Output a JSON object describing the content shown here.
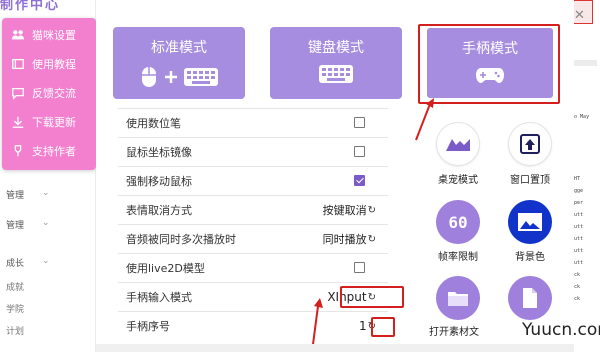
{
  "background_app": {
    "title": "制作中心",
    "menu_items": [
      {
        "label": "管理",
        "icon": "chevron-down-icon"
      },
      {
        "label": "管理",
        "icon": "chevron-down-icon"
      },
      {
        "label": "成长",
        "icon": "chevron-down-icon"
      }
    ],
    "sub_items": [
      "成就",
      "学院",
      "计划"
    ]
  },
  "pink_menu": {
    "color": "#f37fcf",
    "items": [
      {
        "label": "猫咪设置",
        "icon": "users-icon"
      },
      {
        "label": "使用教程",
        "icon": "book-icon"
      },
      {
        "label": "反馈交流",
        "icon": "chat-icon"
      },
      {
        "label": "下载更新",
        "icon": "download-icon"
      },
      {
        "label": "支持作者",
        "icon": "support-icon"
      }
    ]
  },
  "mode_buttons": [
    {
      "label": "标准模式",
      "icon": "mouse-keyboard-icon",
      "active": false
    },
    {
      "label": "键盘模式",
      "icon": "keyboard-icon",
      "active": false
    },
    {
      "label": "手柄模式",
      "icon": "gamepad-icon",
      "active": true
    }
  ],
  "accent_color": "#a78de0",
  "highlight_color": "#d41f1f",
  "settings": [
    {
      "label": "使用数位笔",
      "type": "checkbox",
      "checked": false
    },
    {
      "label": "鼠标坐标镜像",
      "type": "checkbox",
      "checked": false
    },
    {
      "label": "强制移动鼠标",
      "type": "checkbox",
      "checked": true
    },
    {
      "label": "表情取消方式",
      "type": "cycle",
      "value": "按键取消"
    },
    {
      "label": "音频被同时多次播放时",
      "type": "cycle",
      "value": "同时播放"
    },
    {
      "label": "使用live2D模型",
      "type": "checkbox",
      "checked": false
    },
    {
      "label": "手柄输入模式",
      "type": "cycle",
      "value": "XInput"
    },
    {
      "label": "手柄序号",
      "type": "cycle",
      "value": "1"
    }
  ],
  "right_icons": [
    {
      "label": "桌宠模式",
      "icon": "desk-pet-icon"
    },
    {
      "label": "窗口置顶",
      "icon": "pin-top-icon"
    },
    {
      "label": "帧率限制",
      "icon_text": "60",
      "icon": "fps-icon"
    },
    {
      "label": "背景色",
      "icon": "background-color-icon"
    },
    {
      "label": "打开素材文",
      "icon": "folder-icon"
    },
    {
      "label": "",
      "icon": "file-icon"
    }
  ],
  "right_bg": {
    "lines": [
      "Audo May",
      "RIGHT",
      "Trigge",
      "Bumper",
      "Y Butt",
      "X Butt",
      "Z Butt",
      "B Butt",
      "A Butt",
      "Stick",
      "Stick",
      "Stick"
    ]
  },
  "watermark": "Yuucn.com"
}
